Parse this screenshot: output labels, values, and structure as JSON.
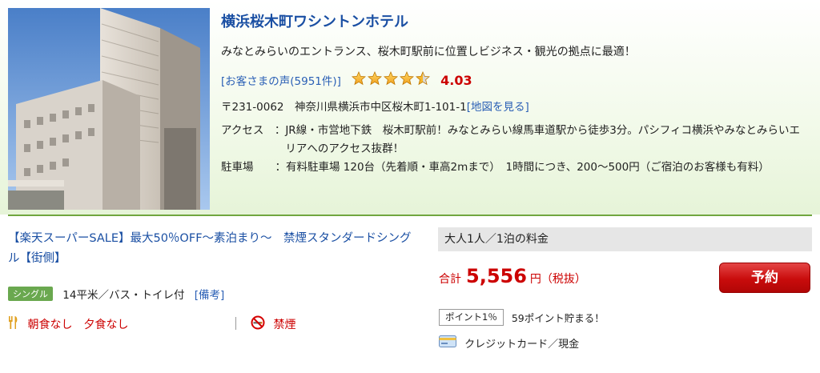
{
  "hotel": {
    "name": "横浜桜木町ワシントンホテル",
    "catch": "みなとみらいのエントランス、桜木町駅前に位置しビジネス・観光の拠点に最適！",
    "review_link": "[お客さまの声(5951件)]",
    "rating": 4.03,
    "rating_text": "4.03",
    "address": "〒231-0062　神奈川県横浜市中区桜木町1-101-1",
    "map_link": "[地図を見る]",
    "access_label": "アクセス　：",
    "access_text": "JR線・市営地下鉄　桜木町駅前！みなとみらい線馬車道駅から徒歩3分。パシフィコ横浜やみなとみらいエリアへのアクセス抜群！",
    "parking_label": "駐車場　　：",
    "parking_text": "有料駐車場 120台（先着順・車高2mまで）　1時間につき、200～500円（ご宿泊のお客様も有料）"
  },
  "plan": {
    "title": "【楽天スーパーSALE】最大50％OFF～素泊まり～　禁煙スタンダードシングル【街側】",
    "room_type": "シングル",
    "room_info": "14平米／バス・トイレ付",
    "biko_link": "[備考]",
    "meal": "朝食なし　夕食なし",
    "smoking": "禁煙"
  },
  "price": {
    "header": "大人1人／1泊の料金",
    "label": "合計",
    "value": "5,556",
    "unit": "円（税抜）",
    "reserve_label": "予約",
    "point_badge": "ポイント1％",
    "point_text": "59ポイント貯まる！",
    "card_text": "クレジットカード／現金"
  },
  "colors": {
    "link": "#1a4fa3",
    "accent_red": "#cc0000",
    "divider_green": "#70a63e",
    "badge_green": "#6aa84f"
  }
}
